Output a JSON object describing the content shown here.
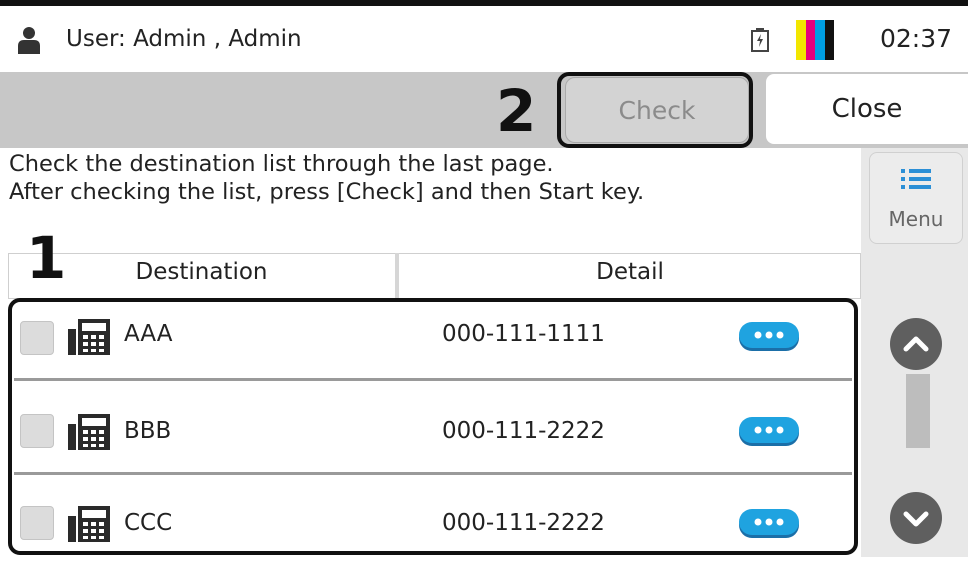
{
  "status": {
    "user": "User: Admin , Admin",
    "time": "02:37",
    "toner_colors": [
      "#f2e600",
      "#e6007e",
      "#009fe3",
      "#111111"
    ]
  },
  "toolbar": {
    "check_label": "Check",
    "close_label": "Close"
  },
  "callouts": {
    "one": "1",
    "two": "2"
  },
  "message": {
    "line1": "Check the destination list through the last page.",
    "line2": "After checking the list, press [Check] and then Start key."
  },
  "menu": {
    "label": "Menu"
  },
  "table": {
    "headers": {
      "destination": "Destination",
      "detail": "Detail"
    },
    "rows": [
      {
        "name": "AAA",
        "number": "000-111-1111"
      },
      {
        "name": "BBB",
        "number": "000-111-2222"
      },
      {
        "name": "CCC",
        "number": "000-111-2222"
      }
    ]
  },
  "icons": [
    "user-icon",
    "battery-icon",
    "toner-indicator",
    "menu-icon",
    "fax-icon",
    "more-details-icon",
    "chevron-up-icon",
    "chevron-down-icon"
  ]
}
